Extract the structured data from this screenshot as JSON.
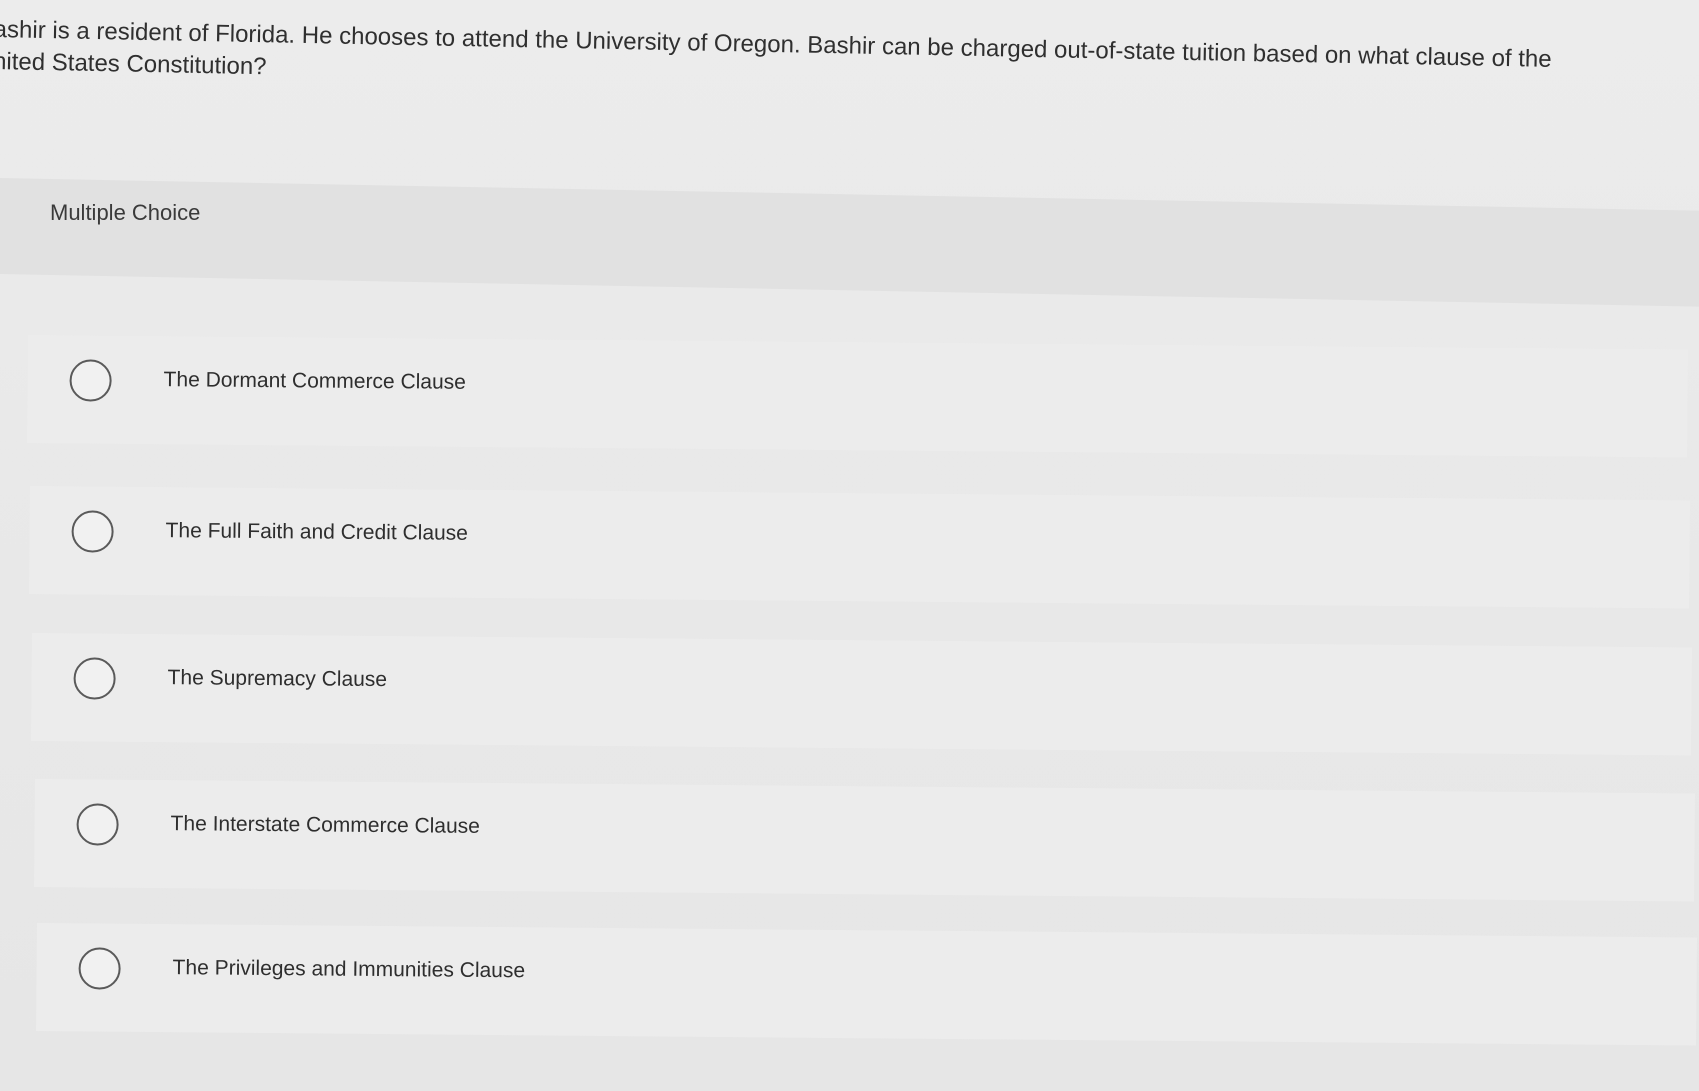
{
  "question": {
    "line1": "ashir is a resident of Florida. He chooses to attend the University of Oregon. Bashir can be charged out-of-state tuition based on what clause of the",
    "line2": "nited States Constitution?"
  },
  "section_label": "Multiple Choice",
  "options": [
    {
      "label": "The Dormant Commerce Clause",
      "selected": false
    },
    {
      "label": "The Full Faith and Credit Clause",
      "selected": false
    },
    {
      "label": "The Supremacy Clause",
      "selected": false
    },
    {
      "label": "The Interstate Commerce Clause",
      "selected": false
    },
    {
      "label": "The Privileges and Immunities Clause",
      "selected": false
    }
  ]
}
